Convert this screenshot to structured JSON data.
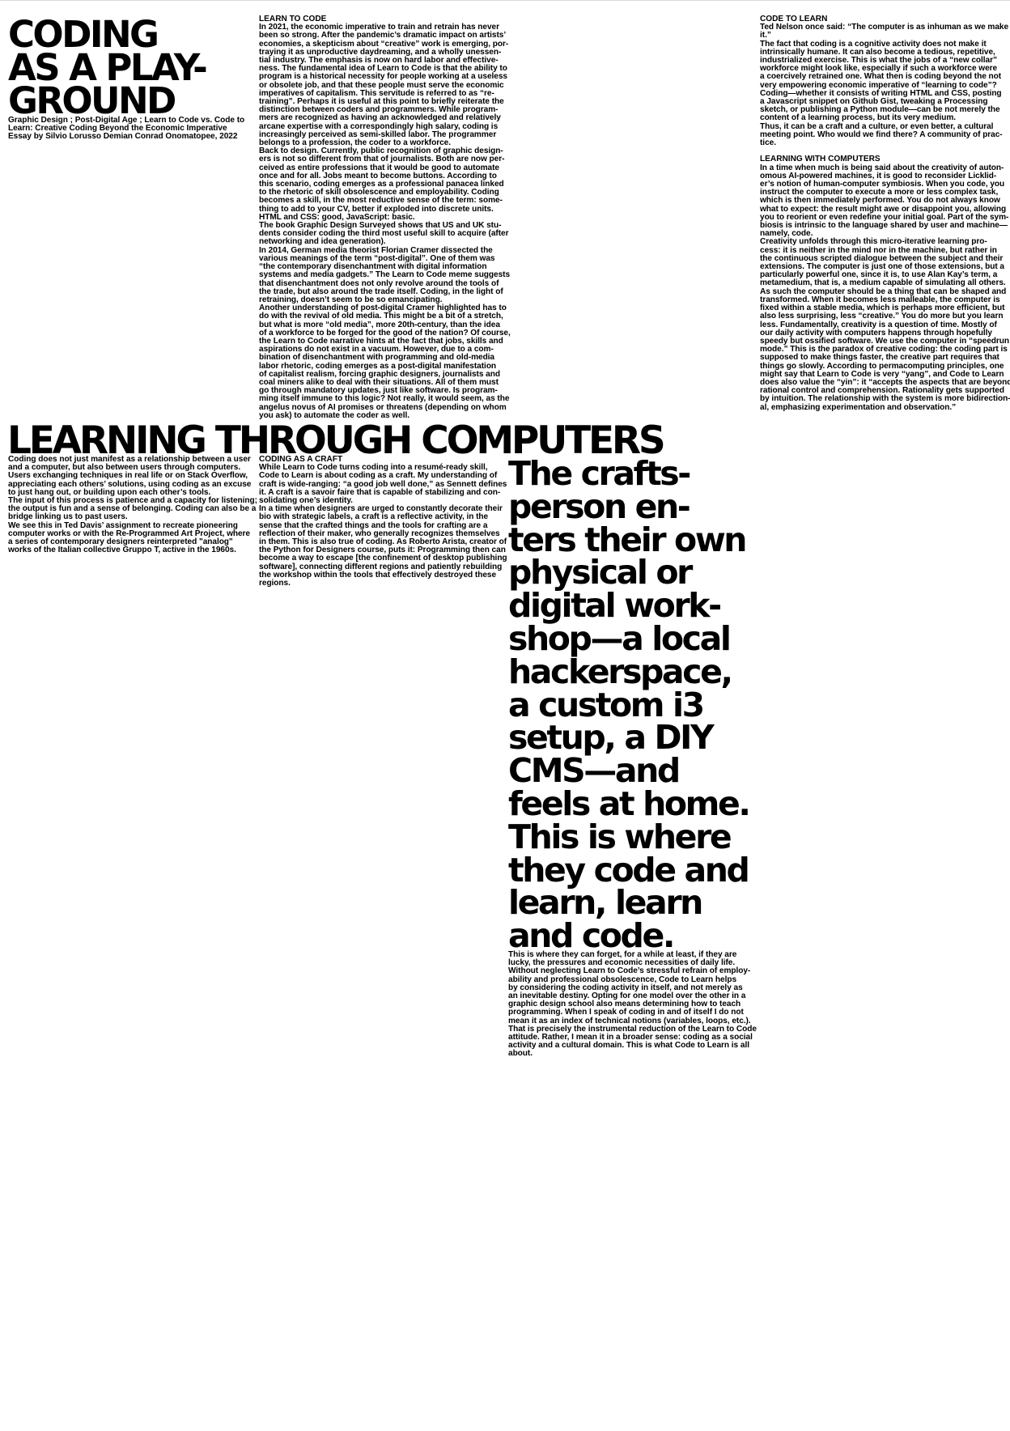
{
  "header": {
    "title": "CODING\nAS A PLAY-\nGROUND",
    "subtitle": "Graphic Design ; Post-Digital Age ; Learn to Code vs. Code to\nLearn: Creative Coding Beyond the Economic Imperative\nEssay by Silvio Lorusso Demian Conrad Onomatopee, 2022"
  },
  "learn_to_code": {
    "heading": "LEARN TO CODE",
    "body": "In 2021, the economic imperative to train and retrain has never\nbeen so strong. After the pandemic’s dramatic impact on artists’\neconomies, a skepticism about “creative” work is emerging, por-\ntraying it as unproductive daydreaming, and a wholly unessen-\ntial industry. The emphasis is now on hard labor and effective-\nness. The fundamental idea of Learn to Code is that the ability to\nprogram is a historical necessity for people working at a useless\nor obsolete job, and that these people must serve the economic\nimperatives of capitalism. This servitude is referred to as “re-\ntraining”. Perhaps it is useful at this point to briefly reiterate the\ndistinction between coders and programmers. While program-\nmers are recognized as having an acknowledged and relatively\narcane expertise with a correspondingly high salary, coding is\nincreasingly perceived as semi-skilled labor. The programmer\nbelongs to a profession, the coder to a workforce.\nBack to design. Currently, public recognition of graphic design-\ners is not so different from that of journalists. Both are now per-\nceived as entire professions that it would be good to automate\nonce and for all. Jobs meant to become buttons. According to\nthis scenario, coding emerges as a professional panacea linked\nto the rhetoric of skill obsolescence and employability. Coding\nbecomes a skill, in the most reductive sense of the term: some-\nthing to add to your CV, better if exploded into discrete units.\nHTML and CSS: good, JavaScript: basic.\nThe book Graphic Design Surveyed shows that US and UK stu-\ndents consider coding the third most useful skill to acquire (after\nnetworking and idea generation).\nIn 2014, German media theorist Florian Cramer dissected the\nvarious meanings of the term “post-digital”. One of them was\n“the contemporary disenchantment with digital information\nsystems and media gadgets.” The Learn to Code meme suggests\nthat disenchantment does not only revolve around the tools of\nthe trade, but also around the trade itself. Coding, in the light of\nretraining, doesn’t seem to be so emancipating.\nAnother understanding of post-digital Cramer highlighted has to\ndo with the revival of old media. This might be a bit of a stretch,\nbut what is more “old media”, more 20th-century, than the idea\nof a workforce to be forged for the good of the nation? Of course,\nthe Learn to Code narrative hints at the fact that jobs, skills and\naspirations do not exist in a vacuum. However, due to a com-\nbination of disenchantment with programming and old-media\nlabor rhetoric, coding emerges as a post-digital manifestation\nof capitalist realism, forcing graphic designers, journalists and\ncoal miners alike to deal with their situations. All of them must\ngo through mandatory updates, just like software. Is program-\nming itself immune to this logic? Not really, it would seem, as the\nangelus novus of AI promises or threatens (depending on whom\nyou ask) to automate the coder as well."
  },
  "code_to_learn": {
    "heading": "CODE TO LEARN",
    "body": "Ted Nelson once said: “The computer is as inhuman as we make\nit.”\nThe fact that coding is a cognitive activity does not make it\nintrinsically humane. It can also become a tedious, repetitive,\nindustrialized exercise. This is what the jobs of a “new collar”\nworkforce might look like, especially if such a workforce were\na coercively retrained one. What then is coding beyond the not\nvery empowering economic imperative of “learning to code”?\nCoding—whether it consists of writing HTML and CSS, posting\na Javascript snippet on Github Gist, tweaking a Processing\nsketch, or publishing a Python module—can be not merely the\ncontent of a learning process, but its very medium.\nThus, it can be a craft and a culture, or even better, a cultural\nmeeting point. Who would we find there? A community of prac-\ntice."
  },
  "learning_with_computers": {
    "heading": "LEARNING WITH COMPUTERS",
    "body": "In a time when much is being said about the creativity of auton-\nomous AI-powered machines, it is good to reconsider Licklid-\ner’s notion of human-computer symbiosis. When you code, you\ninstruct the computer to execute a more or less complex task,\nwhich is then immediately performed. You do not always know\nwhat to expect: the result might awe or disappoint you, allowing\nyou to reorient or even redefine your initial goal. Part of the sym-\nbiosis is intrinsic to the language shared by user and machine—\nnamely, code.\nCreativity unfolds through this micro-iterative learning pro-\ncess: it is neither in the mind nor in the machine, but rather in\nthe continuous scripted dialogue between the subject and their\nextensions. The computer is just one of those extensions, but a\nparticularly powerful one, since it is, to use Alan Kay’s term, a\nmetamedium, that is, a medium capable of simulating all others.\nAs such the computer should be a thing that can be shaped and\ntransformed. When it becomes less malleable, the computer is\nfixed within a stable media, which is perhaps more efficient, but\nalso less surprising, less “creative.” You do more but you learn\nless. Fundamentally, creativity is a question of time. Mostly of\nour daily activity with computers happens through hopefully\nspeedy but ossified software. We use the computer in “speedrun\nmode.” This is the paradox of creative coding: the coding part is\nsupposed to make things faster, the creative part requires that\nthings go slowly. According to permacomputing principles, one\nmight say that Learn to Code is very “yang”, and Code to Learn\ndoes also value the “yin”: it “accepts the aspects that are beyond\nrational control and comprehension. Rationality gets supported\nby intuition. The relationship with the system is more bidirection-\nal, emphasizing experimentation and observation.”"
  },
  "learning_through_computers": {
    "title": "LEARNING THROUGH COMPUTERS",
    "body": "Coding does not just manifest as a relationship between a user\nand a computer, but also between users through computers.\nUsers exchanging techniques in real life or on Stack Overflow,\nappreciating each others’ solutions, using coding as an excuse\nto just hang out, or building upon each other’s tools.\nThe input of this process is patience and a capacity for listening;\nthe output is fun and a sense of belonging. Coding can also be a\nbridge linking us to past users.\nWe see this in Ted Davis’ assignment to recreate pioneering\ncomputer works or with the Re-Programmed Art Project, where\na series of contemporary designers reinterpreted \"analog\"\nworks of the Italian collective Gruppo T, active in the 1960s."
  },
  "coding_as_craft": {
    "heading": "CODING AS A CRAFT",
    "body": "While Learn to Code turns coding into a resumé-ready skill,\nCode to Learn is about coding as a craft. My understanding of\ncraft is wide-ranging: “a good job well done,” as Sennett defines\nit. A craft is a savoir faire that is capable of stabilizing and con-\nsolidating one’s identity.\nIn a time when designers are urged to constantly decorate their\nbio with strategic labels, a craft is a reflective activity, in the\nsense that the crafted things and the tools for crafting are a\nreflection of their maker, who generally recognizes themselves\nin them. This is also true of coding. As Roberto Arista, creator of\nthe Python for Designers course, puts it: Programming then can\nbecome a way to escape [the confinement of desktop publishing\nsoftware], connecting different regions and patiently rebuilding\nthe workshop within the tools that effectively destroyed these\nregions."
  },
  "pull_quote": {
    "text": "The crafts-\nperson en-\nters their own\nphysical or\ndigital work-\nshop—a local\nhackerspace,\na custom i3\nsetup, a DIY\nCMS—and\nfeels at home.\nThis is where\nthey code and\nlearn, learn\nand code."
  },
  "closing": {
    "body": "This is where they can forget, for a while at least, if they are\nlucky, the pressures and economic necessities of daily life.\nWithout neglecting Learn to Code’s stressful refrain of employ-\nability and professional obsolescence, Code to Learn helps\nby considering the coding activity in itself, and not merely as\nan inevitable destiny. Opting for one model over the other in a\ngraphic design school also means determining how to teach\nprogramming. When I speak of coding in and of itself I do not\nmean it as an index of technical notions (variables, loops, etc.).\nThat is precisely the instrumental reduction of the Learn to Code\nattitude. Rather, I mean it in a broader sense: coding as a social\nactivity and a cultural domain. This is what Code to Learn is all\nabout."
  }
}
